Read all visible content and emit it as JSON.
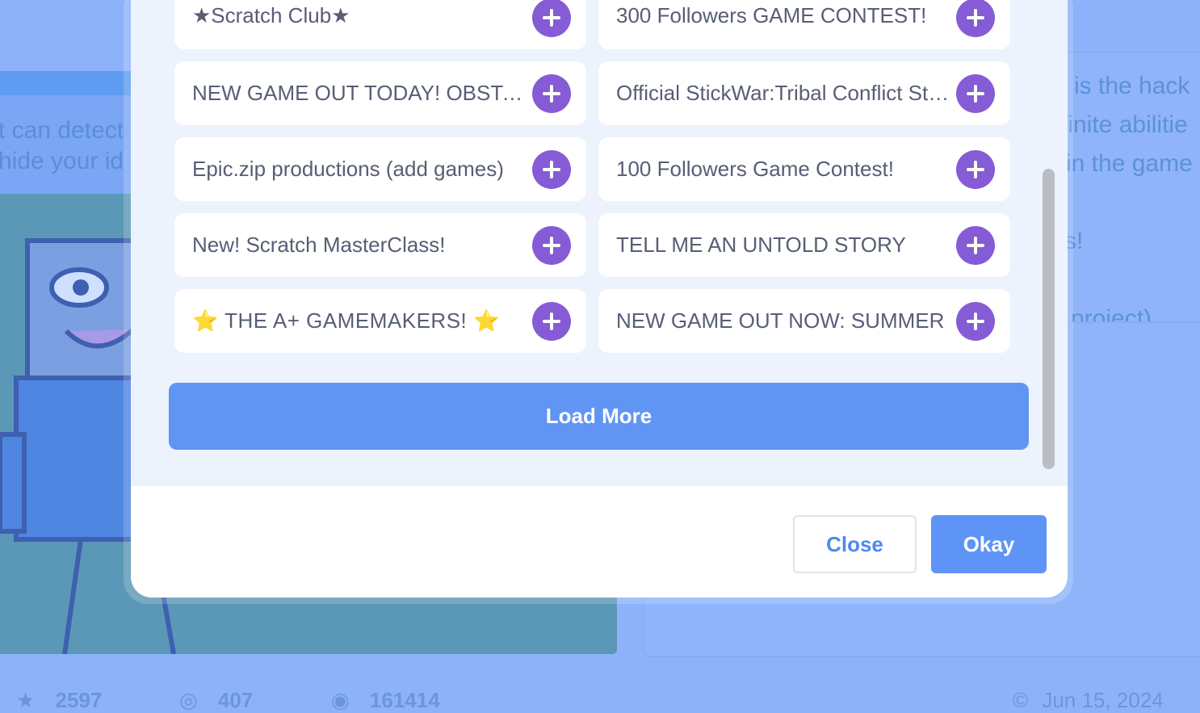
{
  "background": {
    "project_text_lines": [
      "t can detect",
      "hide your id"
    ],
    "notes_text_lines": [
      "is the hack",
      "finite abilitie",
      "in the game",
      "s!",
      "project)"
    ],
    "stats": {
      "loves": "2597",
      "favorites": "407",
      "views": "161414",
      "date": "Jun 15, 2024"
    }
  },
  "modal": {
    "studios": [
      {
        "title": "★Scratch Club★"
      },
      {
        "title": "300 Followers GAME CONTEST!"
      },
      {
        "title": "NEW GAME OUT TODAY! OBSTACLE RACE"
      },
      {
        "title": "Official StickWar:Tribal Conflict Studio"
      },
      {
        "title": "Epic.zip productions (add games)"
      },
      {
        "title": "100 Followers Game Contest!"
      },
      {
        "title": "New! Scratch MasterClass!"
      },
      {
        "title": "TELL ME AN UNTOLD STORY"
      },
      {
        "title": "⭐ THE A+ GAMEMAKERS! ⭐"
      },
      {
        "title": "NEW GAME OUT NOW: SUMMER"
      }
    ],
    "load_more_label": "Load More",
    "close_label": "Close",
    "okay_label": "Okay"
  },
  "colors": {
    "accent": "#855cd6",
    "primary": "#6195f4",
    "text": "#575e75"
  }
}
